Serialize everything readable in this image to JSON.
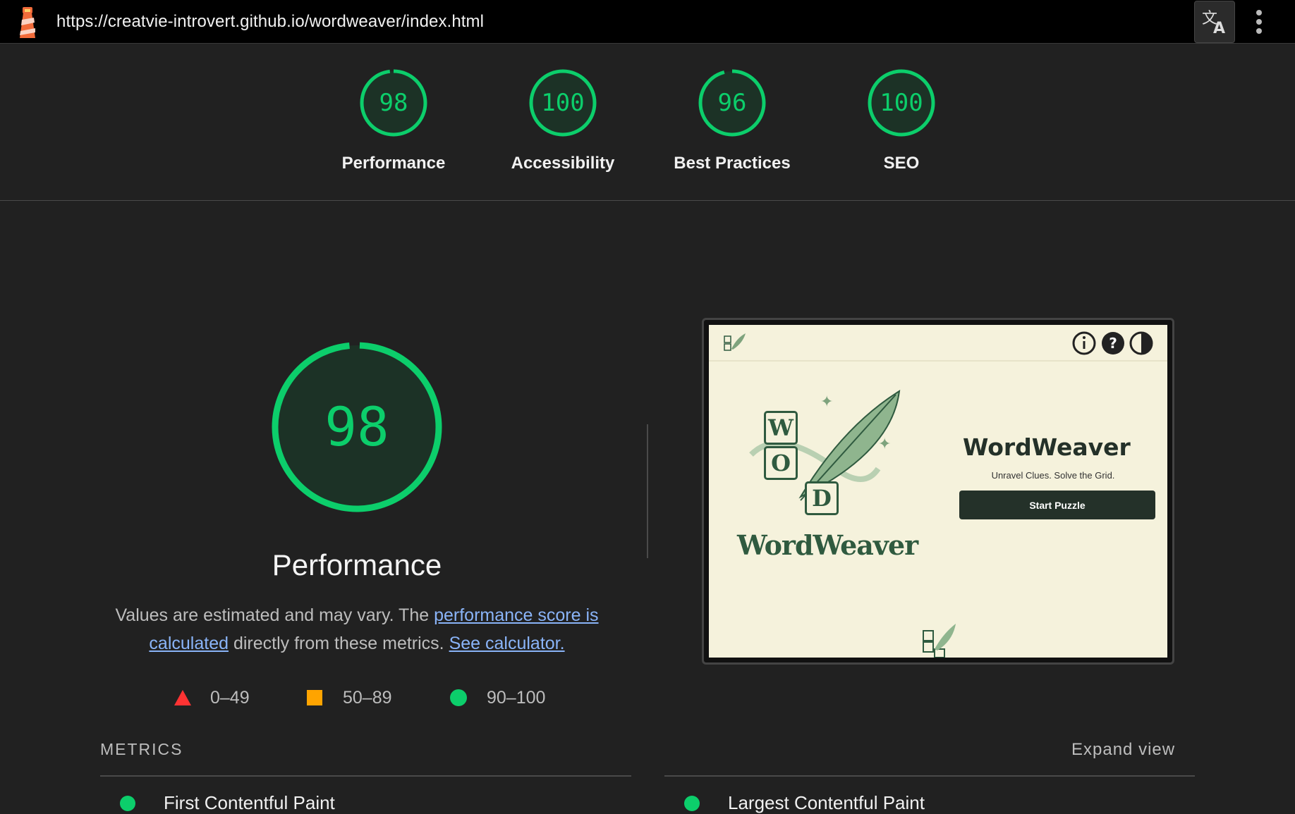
{
  "browser": {
    "url": "https://creatvie-introvert.github.io/wordweaver/index.html",
    "logo_icon": "lighthouse-icon",
    "translate_icon": "translate-icon",
    "menu_icon": "more-vert-icon"
  },
  "scores": [
    {
      "value": "98",
      "label": "Performance"
    },
    {
      "value": "100",
      "label": "Accessibility"
    },
    {
      "value": "96",
      "label": "Best Practices"
    },
    {
      "value": "100",
      "label": "SEO"
    }
  ],
  "colors": {
    "pass": "#0cce6b",
    "average": "#ffa400",
    "fail": "#ff3333",
    "link": "#8ab4f8",
    "bg": "#212121"
  },
  "performance": {
    "score": "98",
    "title": "Performance",
    "desc_prefix": "Values are estimated and may vary. The ",
    "link1": "performance score is calculated",
    "desc_mid": " directly from these metrics. ",
    "link2": "See calculator."
  },
  "legend": [
    {
      "range": "0–49",
      "icon": "triangle-icon"
    },
    {
      "range": "50–89",
      "icon": "square-icon"
    },
    {
      "range": "90–100",
      "icon": "circle-icon"
    }
  ],
  "screenshot": {
    "title": "WordWeaver",
    "tagline": "Unravel Clues. Solve the Grid.",
    "button": "Start Puzzle",
    "brand": "WordWeaver",
    "tiles": [
      "W",
      "O",
      "D"
    ],
    "header_icons": [
      "info-icon",
      "help-icon",
      "contrast-icon"
    ]
  },
  "metrics": {
    "header": "METRICS",
    "expand": "Expand view",
    "items": [
      "First Contentful Paint",
      "Largest Contentful Paint"
    ]
  }
}
